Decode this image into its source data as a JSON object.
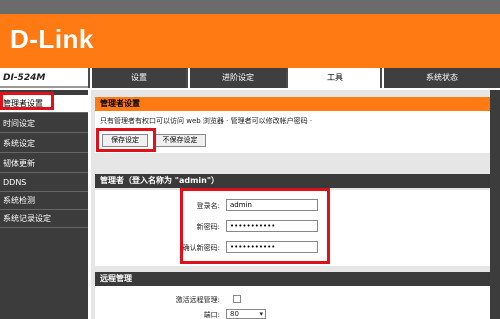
{
  "header": {
    "logo_text": "D-Link",
    "model": "DI-524M"
  },
  "tabs": [
    {
      "label": "设置",
      "active": false
    },
    {
      "label": "进阶设定",
      "active": false
    },
    {
      "label": "工具",
      "active": true
    },
    {
      "label": "系统状态",
      "active": false
    }
  ],
  "sidebar": {
    "items": [
      {
        "label": "管理者设置",
        "active": true
      },
      {
        "label": "时间设定",
        "active": false
      },
      {
        "label": "系统设定",
        "active": false
      },
      {
        "label": "韧体更新",
        "active": false
      },
      {
        "label": "DDNS",
        "active": false
      },
      {
        "label": "系统检测",
        "active": false
      },
      {
        "label": "系统记录设定",
        "active": false
      }
    ]
  },
  "admin_section": {
    "title": "管理者设置",
    "description": "只有管理者有权口可以访问 web 浏览器 · 管理者可以修改帐户密码 ·",
    "save_label": "保存设定",
    "nosave_label": "不保存设定"
  },
  "account_section": {
    "title": "管理者（登入名称为 \"admin\"）",
    "login_label": "登录名:",
    "login_value": "admin",
    "new_password_label": "新密码:",
    "new_password_value": "•••••••••••",
    "confirm_password_label": "确认新密码:",
    "confirm_password_value": "•••••••••••"
  },
  "remote_section": {
    "title": "远程管理",
    "enable_label": "激活远程管理:",
    "enable_checked": false,
    "port_label": "端口:",
    "port_value": "80"
  },
  "colors": {
    "brand_orange": "#ff7a12",
    "highlight_red": "#e0101a",
    "dark_bar": "#3a3a3a"
  }
}
